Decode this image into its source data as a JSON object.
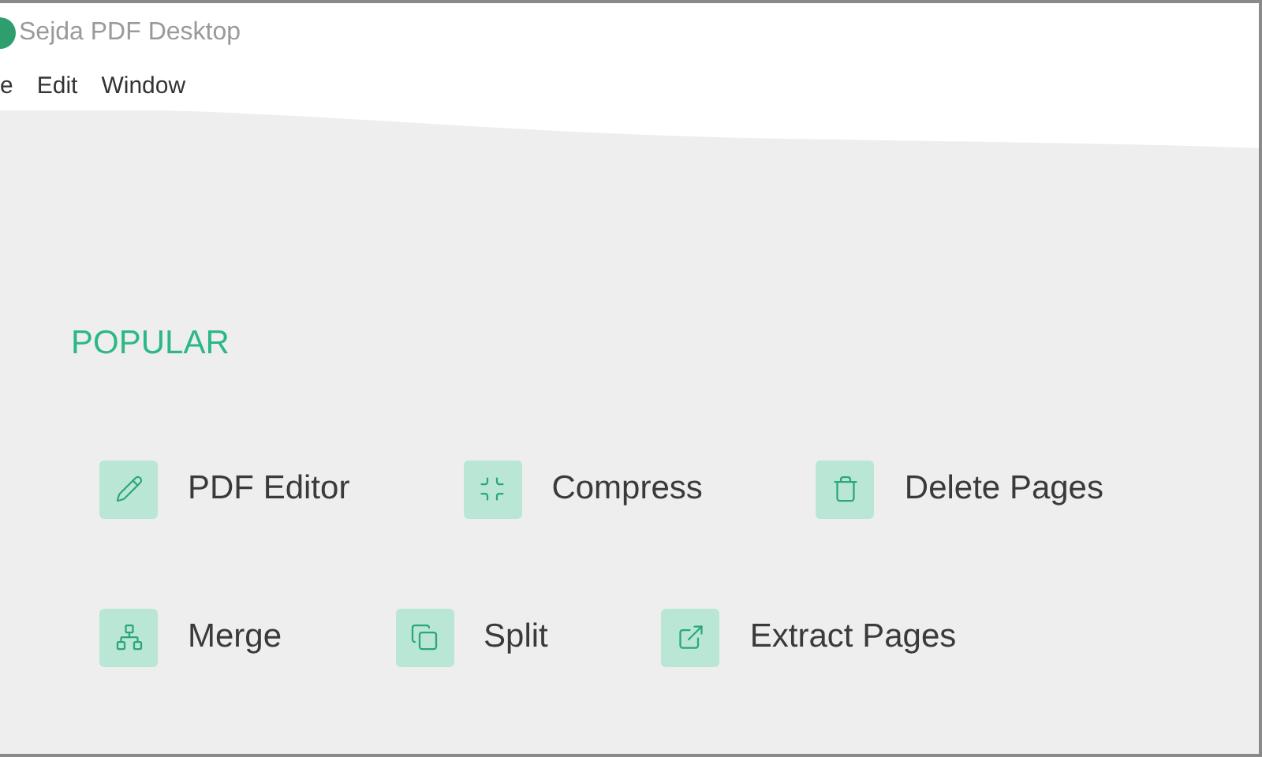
{
  "window": {
    "title": "Sejda PDF Desktop"
  },
  "menu": [
    "e",
    "Edit",
    "Window"
  ],
  "section": {
    "title": "POPULAR"
  },
  "tool_rows": [
    [
      "PDF Editor",
      "Compress",
      "Delete Pages"
    ],
    [
      "Merge",
      "Split",
      "Extract Pages"
    ]
  ]
}
